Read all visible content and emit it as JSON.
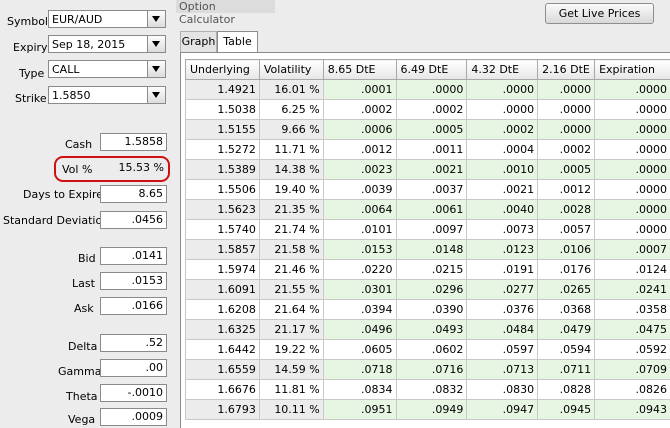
{
  "form": {
    "symbol": {
      "label": "Symbol",
      "value": "EUR/AUD"
    },
    "expiry": {
      "label": "Expiry",
      "value": "Sep 18, 2015"
    },
    "type": {
      "label": "Type",
      "value": "CALL"
    },
    "strike": {
      "label": "Strike",
      "value": "1.5850"
    }
  },
  "fields": {
    "cash": {
      "label": "Cash",
      "value": "1.5858"
    },
    "vol": {
      "label": "Vol %",
      "value": "15.53 %"
    },
    "days": {
      "label": "Days to Expire",
      "value": "8.65"
    },
    "stddev": {
      "label": "Standard Deviation",
      "value": ".0456"
    },
    "bid": {
      "label": "Bid",
      "value": ".0141"
    },
    "last": {
      "label": "Last",
      "value": ".0153"
    },
    "ask": {
      "label": "Ask",
      "value": ".0166"
    },
    "delta": {
      "label": "Delta",
      "value": ".52"
    },
    "gamma": {
      "label": "Gamma",
      "value": ".00"
    },
    "theta": {
      "label": "Theta",
      "value": "-.0010"
    },
    "vega": {
      "label": "Vega",
      "value": ".0009"
    }
  },
  "window": {
    "title": "Option Calculator",
    "live_button": "Get Live Prices"
  },
  "tabs": {
    "graph": "Graph",
    "table": "Table"
  },
  "table": {
    "columns": [
      "Underlying",
      "Volatility",
      "8.65 DtE",
      "6.49 DtE",
      "4.32 DtE",
      "2.16 DtE",
      "Expiration"
    ],
    "rows": [
      [
        "1.4921",
        "16.01 %",
        ".0001",
        ".0000",
        ".0000",
        ".0000",
        ".0000"
      ],
      [
        "1.5038",
        "6.25 %",
        ".0002",
        ".0002",
        ".0000",
        ".0000",
        ".0000"
      ],
      [
        "1.5155",
        "9.66 %",
        ".0006",
        ".0005",
        ".0002",
        ".0000",
        ".0000"
      ],
      [
        "1.5272",
        "11.71 %",
        ".0012",
        ".0011",
        ".0004",
        ".0002",
        ".0000"
      ],
      [
        "1.5389",
        "14.38 %",
        ".0023",
        ".0021",
        ".0010",
        ".0005",
        ".0000"
      ],
      [
        "1.5506",
        "19.40 %",
        ".0039",
        ".0037",
        ".0021",
        ".0012",
        ".0000"
      ],
      [
        "1.5623",
        "21.35 %",
        ".0064",
        ".0061",
        ".0040",
        ".0028",
        ".0000"
      ],
      [
        "1.5740",
        "21.74 %",
        ".0101",
        ".0097",
        ".0073",
        ".0057",
        ".0000"
      ],
      [
        "1.5857",
        "21.58 %",
        ".0153",
        ".0148",
        ".0123",
        ".0106",
        ".0007"
      ],
      [
        "1.5974",
        "21.46 %",
        ".0220",
        ".0215",
        ".0191",
        ".0176",
        ".0124"
      ],
      [
        "1.6091",
        "21.55 %",
        ".0301",
        ".0296",
        ".0277",
        ".0265",
        ".0241"
      ],
      [
        "1.6208",
        "21.64 %",
        ".0394",
        ".0390",
        ".0376",
        ".0368",
        ".0358"
      ],
      [
        "1.6325",
        "21.17 %",
        ".0496",
        ".0493",
        ".0484",
        ".0479",
        ".0475"
      ],
      [
        "1.6442",
        "19.22 %",
        ".0605",
        ".0602",
        ".0597",
        ".0594",
        ".0592"
      ],
      [
        "1.6559",
        "14.59 %",
        ".0718",
        ".0716",
        ".0713",
        ".0711",
        ".0709"
      ],
      [
        "1.6676",
        "11.81 %",
        ".0834",
        ".0832",
        ".0830",
        ".0828",
        ".0826"
      ],
      [
        "1.6793",
        "10.11 %",
        ".0951",
        ".0949",
        ".0947",
        ".0945",
        ".0943"
      ]
    ]
  }
}
